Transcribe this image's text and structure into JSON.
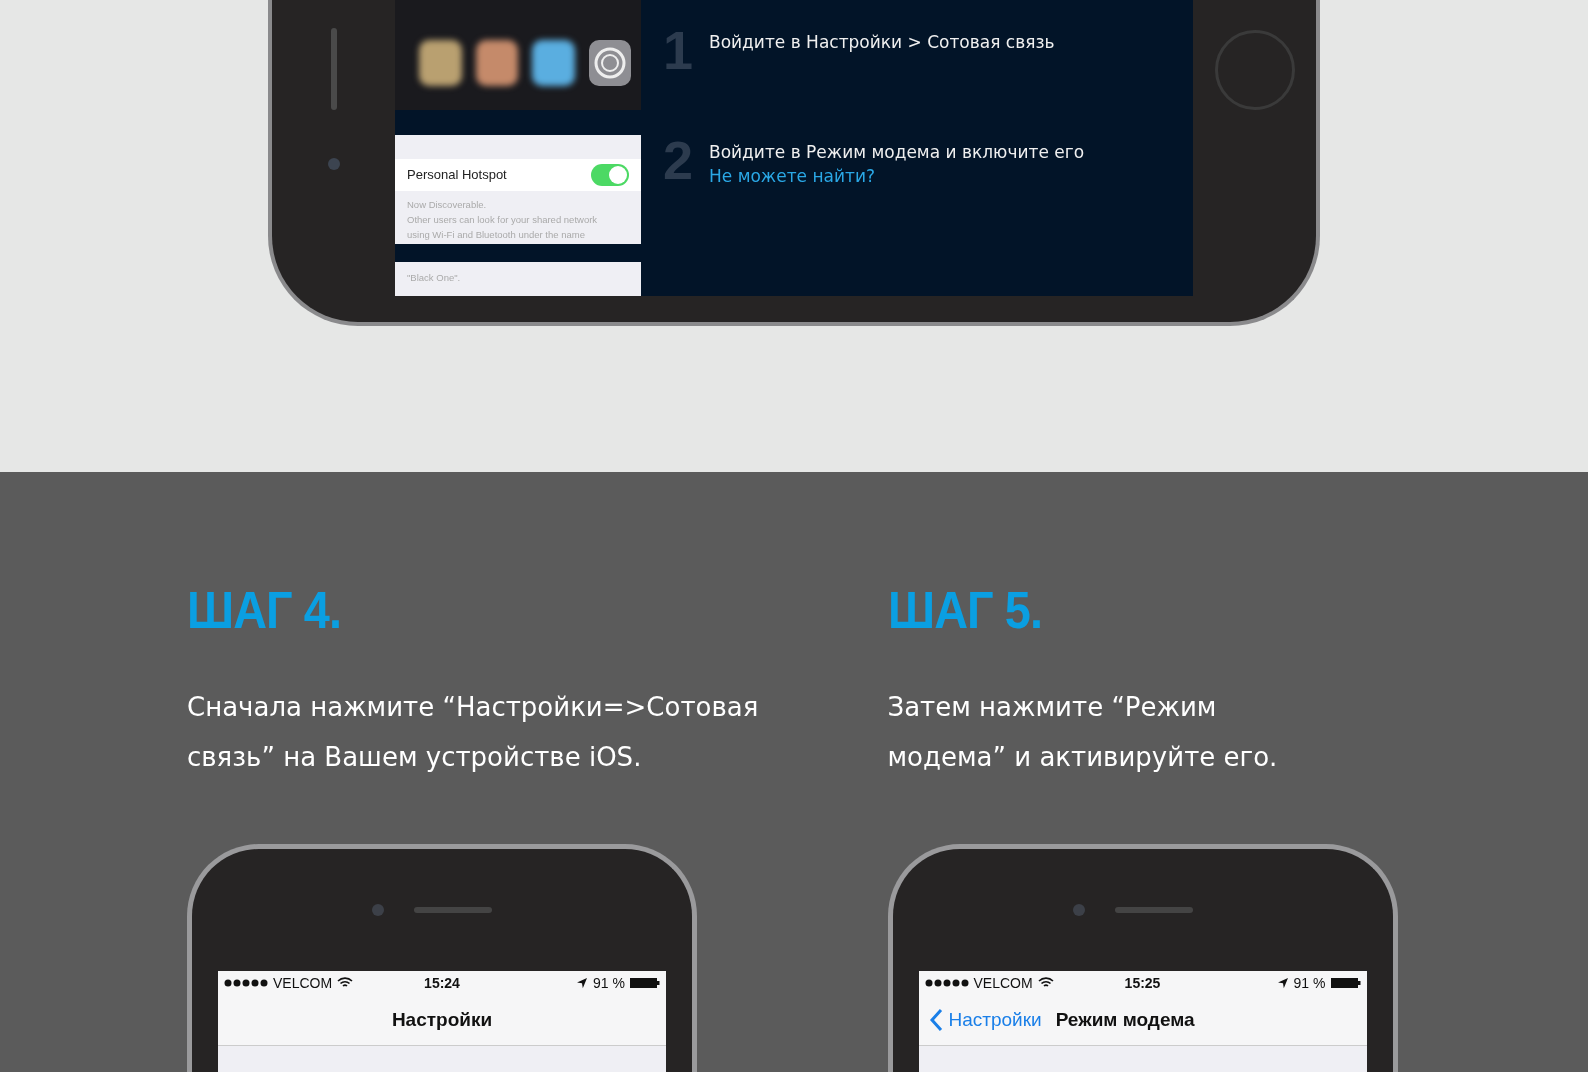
{
  "hero_phone": {
    "inset": {
      "toggle_label": "Personal Hotspot",
      "toggle_on": true,
      "note_lines": [
        "Now Discoverable.",
        "Other users can look for your shared network",
        "using Wi-Fi and Bluetooth under the name"
      ],
      "note_continued": "\"Black One\"."
    },
    "steps": [
      {
        "number": "1",
        "text": "Войдите в Настройки > Сотовая связь"
      },
      {
        "number": "2",
        "text": "Войдите в Режим модема и включите его",
        "link": "Не можете найти?"
      }
    ]
  },
  "steps": [
    {
      "heading": "ШАГ 4.",
      "description_lines": [
        "Сначала нажмите “Настройки=>Сотовая",
        "связь” на Вашем устройстве iOS."
      ],
      "phone": {
        "carrier": "VELCOM",
        "time": "15:24",
        "battery": "91 %",
        "title": "Настройки"
      }
    },
    {
      "heading": "ШАГ 5.",
      "description_lines": [
        "Затем нажмите “Режим",
        "модема” и активируйте его."
      ],
      "phone": {
        "carrier": "VELCOM",
        "time": "15:25",
        "battery": "91 %",
        "back_label": "Настройки",
        "title": "Режим модема"
      }
    }
  ]
}
